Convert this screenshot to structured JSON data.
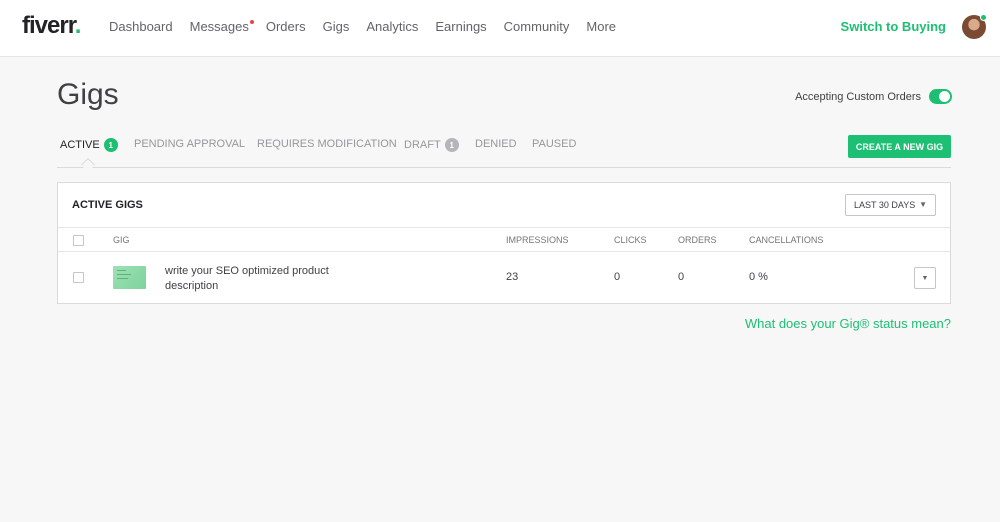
{
  "brand": {
    "name": "fiverr",
    "dot": "."
  },
  "nav": {
    "links": [
      "Dashboard",
      "Messages",
      "Orders",
      "Gigs",
      "Analytics",
      "Earnings",
      "Community",
      "More"
    ],
    "switch_label": "Switch to Buying"
  },
  "page": {
    "title": "Gigs",
    "custom_orders_label": "Accepting Custom Orders",
    "custom_orders_enabled": true
  },
  "tabs": [
    {
      "label": "ACTIVE",
      "badge": "1"
    },
    {
      "label": "PENDING APPROVAL"
    },
    {
      "label": "REQUIRES MODIFICATION"
    },
    {
      "label": "DRAFT",
      "badge": "1"
    },
    {
      "label": "DENIED"
    },
    {
      "label": "PAUSED"
    }
  ],
  "create_button": "CREATE A NEW GIG",
  "table": {
    "title": "ACTIVE GIGS",
    "period": "LAST 30 DAYS",
    "columns": [
      "GIG",
      "IMPRESSIONS",
      "CLICKS",
      "ORDERS",
      "CANCELLATIONS"
    ],
    "rows": [
      {
        "gig": "write your SEO optimized product description",
        "impressions": "23",
        "clicks": "0",
        "orders": "0",
        "cancellations": "0 %"
      }
    ]
  },
  "status_link": "What does your Gig® status mean?",
  "icons": {
    "dropdown": "caret-down-icon",
    "row_menu": "caret-down-icon"
  },
  "colors": {
    "brand_green": "#1dbf73",
    "notification": "#e0474c"
  }
}
